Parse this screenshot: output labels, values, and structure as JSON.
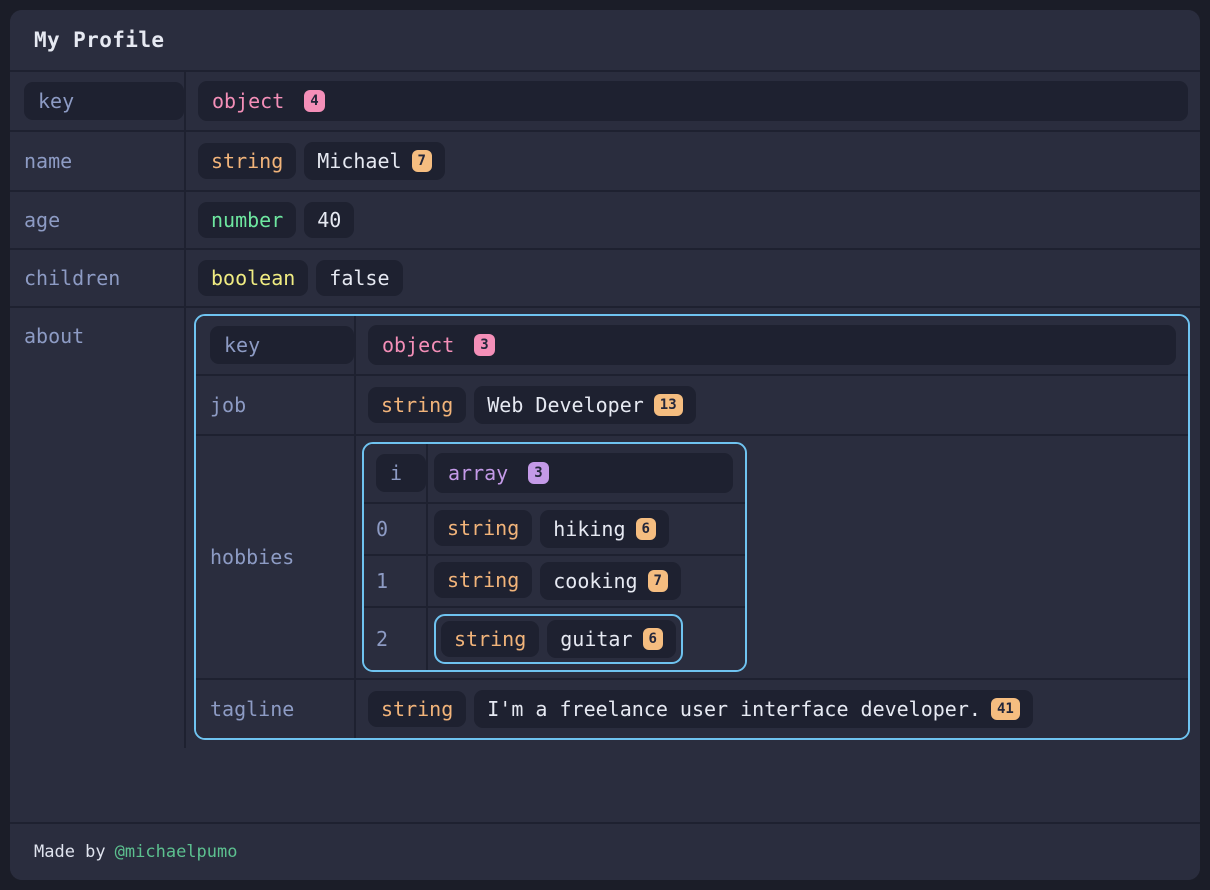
{
  "page": {
    "title": "My Profile",
    "accent_border": "#6fc3f0",
    "panel_bg": "#2a2d3e",
    "page_bg": "#1b1d28"
  },
  "footer": {
    "made_by": "Made by",
    "handle": "@michaelpumo"
  },
  "header_row": {
    "key_label": "key",
    "type": "object",
    "count": "4"
  },
  "rows": [
    {
      "key": "name",
      "type": "string",
      "value": "Michael",
      "count": "7"
    },
    {
      "key": "age",
      "type": "number",
      "value": "40",
      "count": ""
    },
    {
      "key": "children",
      "type": "boolean",
      "value": "false",
      "count": ""
    }
  ],
  "about": {
    "key": "about",
    "header_row": {
      "key_label": "key",
      "type": "object",
      "count": "3"
    },
    "job": {
      "key": "job",
      "type": "string",
      "value": "Web Developer",
      "count": "13"
    },
    "hobbies": {
      "key": "hobbies",
      "header_row": {
        "key_label": "i",
        "type": "array",
        "count": "3"
      },
      "items": [
        {
          "index": "0",
          "type": "string",
          "value": "hiking",
          "count": "6"
        },
        {
          "index": "1",
          "type": "string",
          "value": "cooking",
          "count": "7"
        },
        {
          "index": "2",
          "type": "string",
          "value": "guitar",
          "count": "6"
        }
      ]
    },
    "tagline": {
      "key": "tagline",
      "type": "string",
      "value": "I'm a freelance user interface developer.",
      "count": "41"
    }
  }
}
